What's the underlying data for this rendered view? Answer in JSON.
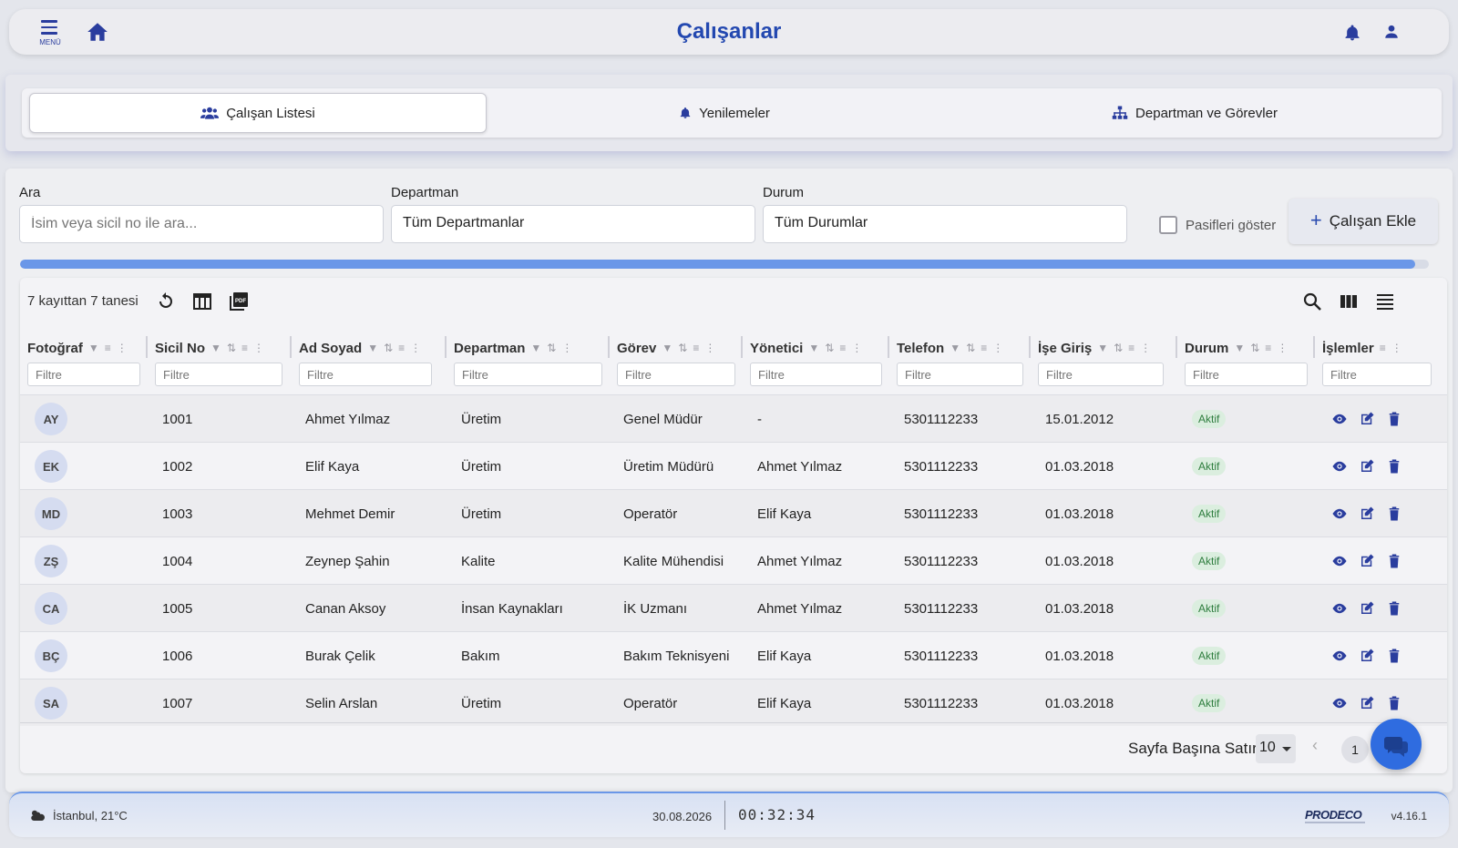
{
  "header": {
    "menu_label": "MENÜ",
    "title": "Çalışanlar"
  },
  "tabs": [
    {
      "label": "Çalışan Listesi",
      "icon": "users-icon",
      "active": true
    },
    {
      "label": "Yenilemeler",
      "icon": "bell-icon",
      "active": false
    },
    {
      "label": "Departman ve Görevler",
      "icon": "sitemap-icon",
      "active": false
    }
  ],
  "filters": {
    "search": {
      "label": "Ara",
      "placeholder": "İsim veya sicil no ile ara..."
    },
    "department": {
      "label": "Departman",
      "value": "Tüm Departmanlar"
    },
    "status": {
      "label": "Durum",
      "value": "Tüm Durumlar"
    },
    "show_passive_label": "Pasifleri göster",
    "add_button_label": "Çalışan Ekle"
  },
  "progress": 0.99,
  "table": {
    "record_count": "7 kayıttan 7 tanesi",
    "filter_placeholder": "Filtre",
    "columns": [
      "Fotoğraf",
      "Sicil No",
      "Ad Soyad",
      "Departman",
      "Görev",
      "Yönetici",
      "Telefon",
      "İşe Giriş",
      "Durum",
      "İşlemler"
    ],
    "rows": [
      {
        "initials": "AY",
        "sicil": "1001",
        "name": "Ahmet Yılmaz",
        "dept": "Üretim",
        "role": "Genel Müdür",
        "manager": "-",
        "phone": "5301112233",
        "start": "15.01.2012",
        "status": "Aktif"
      },
      {
        "initials": "EK",
        "sicil": "1002",
        "name": "Elif Kaya",
        "dept": "Üretim",
        "role": "Üretim Müdürü",
        "manager": "Ahmet Yılmaz",
        "phone": "5301112233",
        "start": "01.03.2018",
        "status": "Aktif"
      },
      {
        "initials": "MD",
        "sicil": "1003",
        "name": "Mehmet Demir",
        "dept": "Üretim",
        "role": "Operatör",
        "manager": "Elif Kaya",
        "phone": "5301112233",
        "start": "01.03.2018",
        "status": "Aktif"
      },
      {
        "initials": "ZŞ",
        "sicil": "1004",
        "name": "Zeynep Şahin",
        "dept": "Kalite",
        "role": "Kalite Mühendisi",
        "manager": "Ahmet Yılmaz",
        "phone": "5301112233",
        "start": "01.03.2018",
        "status": "Aktif"
      },
      {
        "initials": "CA",
        "sicil": "1005",
        "name": "Canan Aksoy",
        "dept": "İnsan Kaynakları",
        "role": "İK Uzmanı",
        "manager": "Ahmet Yılmaz",
        "phone": "5301112233",
        "start": "01.03.2018",
        "status": "Aktif"
      },
      {
        "initials": "BÇ",
        "sicil": "1006",
        "name": "Burak Çelik",
        "dept": "Bakım",
        "role": "Bakım Teknisyeni",
        "manager": "Elif Kaya",
        "phone": "5301112233",
        "start": "01.03.2018",
        "status": "Aktif"
      },
      {
        "initials": "SA",
        "sicil": "1007",
        "name": "Selin Arslan",
        "dept": "Üretim",
        "role": "Operatör",
        "manager": "Elif Kaya",
        "phone": "5301112233",
        "start": "01.03.2018",
        "status": "Aktif"
      }
    ],
    "pagination": {
      "rows_per_page_label": "Sayfa Başına Satır",
      "rows_per_page": "10",
      "current_page": "1"
    }
  },
  "footer": {
    "weather": "İstanbul, 21°C",
    "date": "30.08.2026",
    "clock": "00:32:34",
    "brand": "PRODECO",
    "version": "v4.16.1"
  },
  "colors": {
    "accent": "#2348b0",
    "progress": "#6a97e8",
    "status_active_bg": "#dbeedf",
    "status_active_text": "#2e7d3e",
    "chat_button": "#2f6ce0"
  }
}
